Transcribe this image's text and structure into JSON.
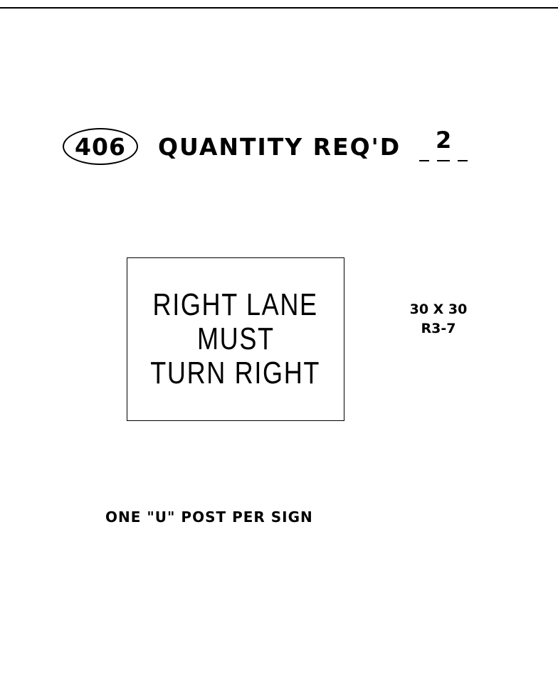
{
  "header": {
    "item_number": "406",
    "quantity_label": "QUANTITY REQ'D",
    "quantity_value": "2"
  },
  "sign": {
    "lines": [
      "RIGHT LANE",
      "MUST",
      "TURN RIGHT"
    ],
    "size": "30 X 30",
    "code": "R3-7"
  },
  "note": "ONE \"U\" POST PER SIGN"
}
